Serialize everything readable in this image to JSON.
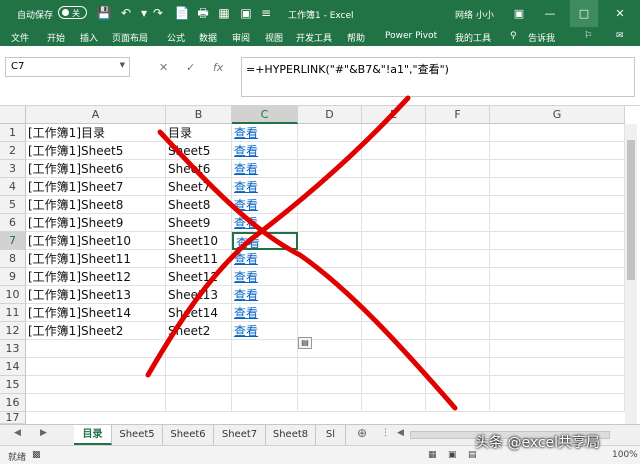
{
  "titlebar": {
    "autosave_label": "自动保存",
    "autosave_state": "关",
    "doc_title": "工作簿1 - Excel",
    "user": "网络 小小",
    "undo_icon": "undo-icon",
    "redo_icon": "redo-icon"
  },
  "menu": [
    "文件",
    "开始",
    "插入",
    "页面布局",
    "公式",
    "数据",
    "审阅",
    "视图",
    "开发工具",
    "帮助",
    "Power Pivot",
    "我的工具",
    "告诉我"
  ],
  "formula_bar": {
    "name_box": "C7",
    "formula": "=+HYPERLINK(\"#\"&B7&\"!a1\",\"查看\")",
    "fx": "fx"
  },
  "columns": [
    "A",
    "B",
    "C",
    "D",
    "E",
    "F",
    "G"
  ],
  "selected_column": "C",
  "selected_row": 7,
  "rows": [
    {
      "n": "1",
      "a": "[工作簿1]目录",
      "b": "目录",
      "c": "查看"
    },
    {
      "n": "2",
      "a": "[工作簿1]Sheet5",
      "b": "Sheet5",
      "c": "查看"
    },
    {
      "n": "3",
      "a": "[工作簿1]Sheet6",
      "b": "Sheet6",
      "c": "查看"
    },
    {
      "n": "4",
      "a": "[工作簿1]Sheet7",
      "b": "Sheet7",
      "c": "查看"
    },
    {
      "n": "5",
      "a": "[工作簿1]Sheet8",
      "b": "Sheet8",
      "c": "查看"
    },
    {
      "n": "6",
      "a": "[工作簿1]Sheet9",
      "b": "Sheet9",
      "c": "查看"
    },
    {
      "n": "7",
      "a": "[工作簿1]Sheet10",
      "b": "Sheet10",
      "c": "查看"
    },
    {
      "n": "8",
      "a": "[工作簿1]Sheet11",
      "b": "Sheet11",
      "c": "查看"
    },
    {
      "n": "9",
      "a": "[工作簿1]Sheet12",
      "b": "Sheet12",
      "c": "查看"
    },
    {
      "n": "10",
      "a": "[工作簿1]Sheet13",
      "b": "Sheet13",
      "c": "查看"
    },
    {
      "n": "11",
      "a": "[工作簿1]Sheet14",
      "b": "Sheet14",
      "c": "查看"
    },
    {
      "n": "12",
      "a": "[工作簿1]Sheet2",
      "b": "Sheet2",
      "c": "查看"
    },
    {
      "n": "13",
      "a": "",
      "b": "",
      "c": ""
    },
    {
      "n": "15",
      "a": "",
      "b": "",
      "c": ""
    },
    {
      "n": "16",
      "a": "",
      "b": "",
      "c": ""
    },
    {
      "n": "17",
      "a": "",
      "b": "",
      "c": ""
    }
  ],
  "row_header_14": "14",
  "sheet_tabs": [
    "目录",
    "Sheet5",
    "Sheet6",
    "Sheet7",
    "Sheet8",
    "Sl"
  ],
  "active_tab": "目录",
  "status": {
    "ready": "就绪",
    "zoom": "100%"
  },
  "watermark": "头条 @excel共享局",
  "colors": {
    "excel_green": "#217346",
    "link_blue": "#0563c1",
    "annotation_red": "#e00000"
  }
}
